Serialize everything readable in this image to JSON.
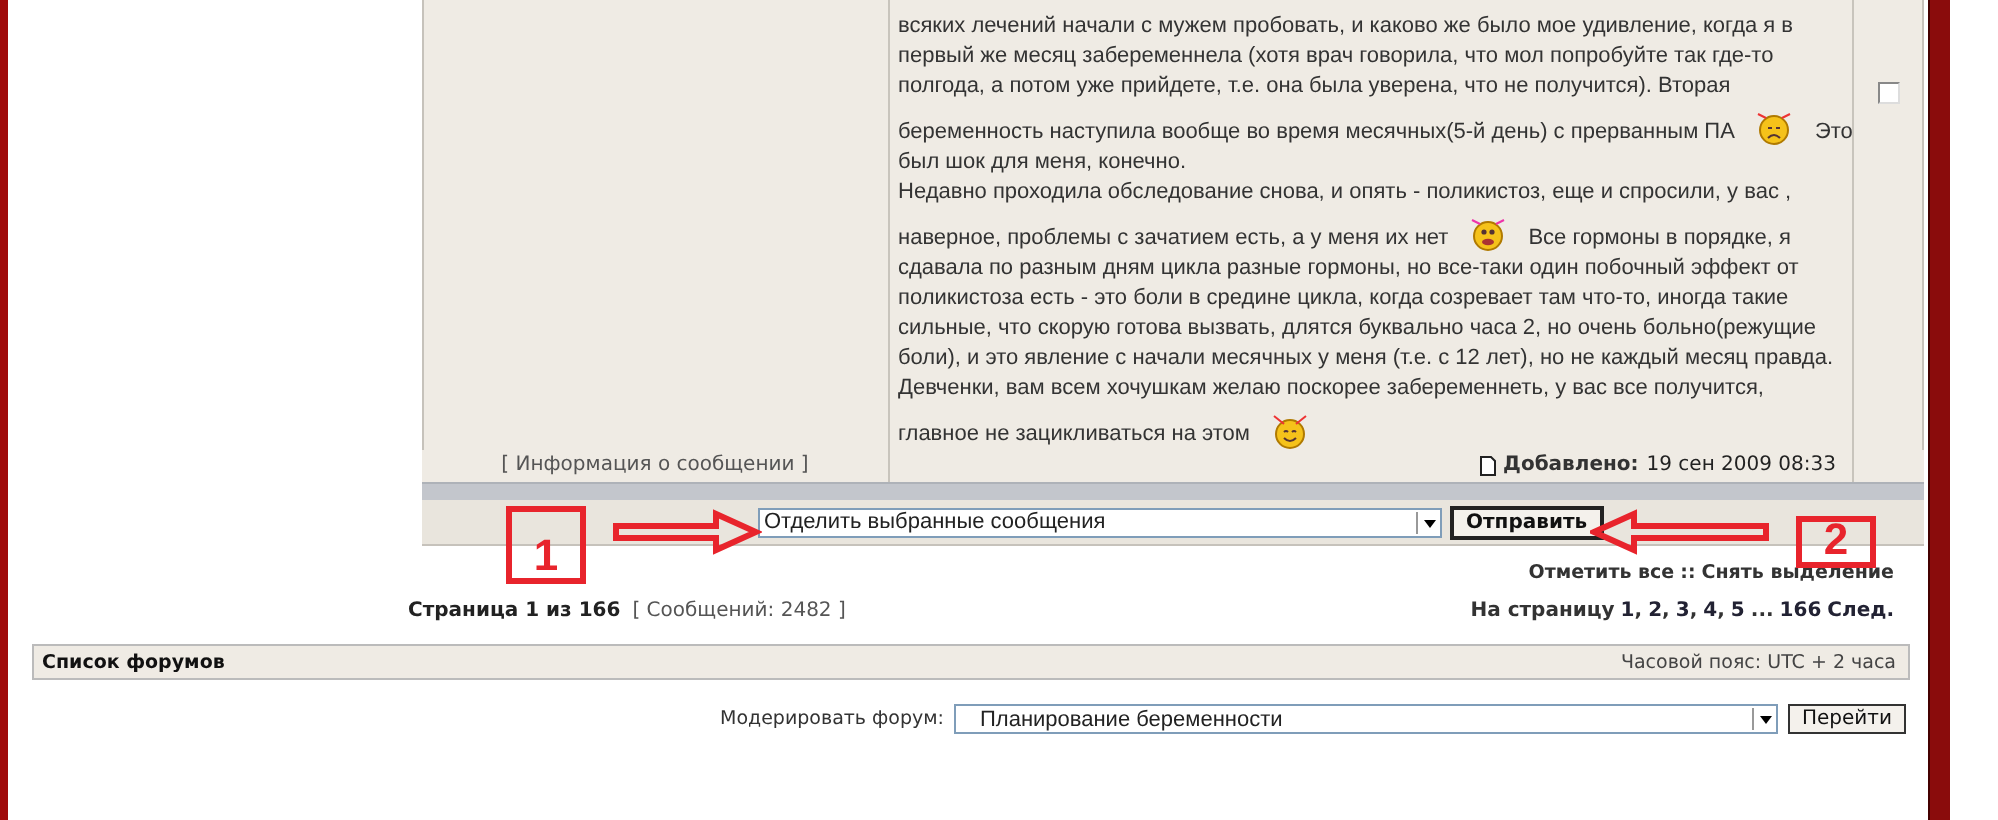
{
  "post": {
    "lines": [
      {
        "text": "всяких лечений начали с мужем пробовать, и каково же было мое удивление, когда я в"
      },
      {
        "text": "первый же месяц забеременнела (хотя врач говорила, что мол попробуйте так где-то"
      },
      {
        "text": "полгода, а потом уже прийдете, т.е. она была уверена, что не получится). Вторая"
      },
      {
        "text": "беременность наступила вообще во время месячных(5-й день) с прерванным ПА",
        "smiley": {
          "kind": "sad"
        },
        "after": "Это"
      },
      {
        "text": "был шок для меня, конечно."
      },
      {
        "text": "Недавно проходила обследование снова, и опять - поликистоз, еще и спросили, у вас ,"
      },
      {
        "text": "наверное, проблемы с зачатием есть, а у меня их нет",
        "smiley": {
          "kind": "excited"
        },
        "after": "Все гормоны в порядке, я"
      },
      {
        "text": "сдавала по разным дням цикла разные гормоны, но все-таки один побочный эффект от"
      },
      {
        "text": "поликистоза есть - это боли в средине цикла, когда созревает там что-то, иногда такие"
      },
      {
        "text": "сильные, что скорую готова вызвать, длятся буквально часа 2, но очень больно(режущие"
      },
      {
        "text": "боли), и это явление с начали месячных у меня (т.е. с 12 лет), но не каждый месяц правда."
      },
      {
        "text": "Девченки, вам всем хочушкам желаю поскорее забеременнеть, у вас все получится,"
      },
      {
        "text": "главное не зацикливаться на этом",
        "smiley": {
          "kind": "happy"
        }
      }
    ],
    "checked": false,
    "info_link": "[ Информация о сообщении ]",
    "added_label": "Добавлено:",
    "added_date": "19 сен 2009 08:33"
  },
  "moderation_bar": {
    "action": "Отделить выбранные сообщения",
    "submit": "Отправить"
  },
  "annotations": [
    {
      "label": "1"
    },
    {
      "label": "2"
    }
  ],
  "selection": {
    "mark_all": "Отметить все",
    "separator": "::",
    "unmark_all": "Снять выделение"
  },
  "pagination": {
    "page_label": "Страница 1 из 166",
    "count": "[ Сообщений: 2482 ]",
    "goto_label": "На страницу",
    "pages": [
      "1",
      "2",
      "3",
      "4",
      "5"
    ],
    "page_separator": ",",
    "ellipsis": "...",
    "last": "166",
    "next": "След."
  },
  "forum_bar": {
    "title": "Список форумов",
    "timezone": "Часовой пояс: UTC + 2 часа"
  },
  "moderate": {
    "label": "Модерировать форум:",
    "forum": "Планирование беременности",
    "button": "Перейти"
  }
}
